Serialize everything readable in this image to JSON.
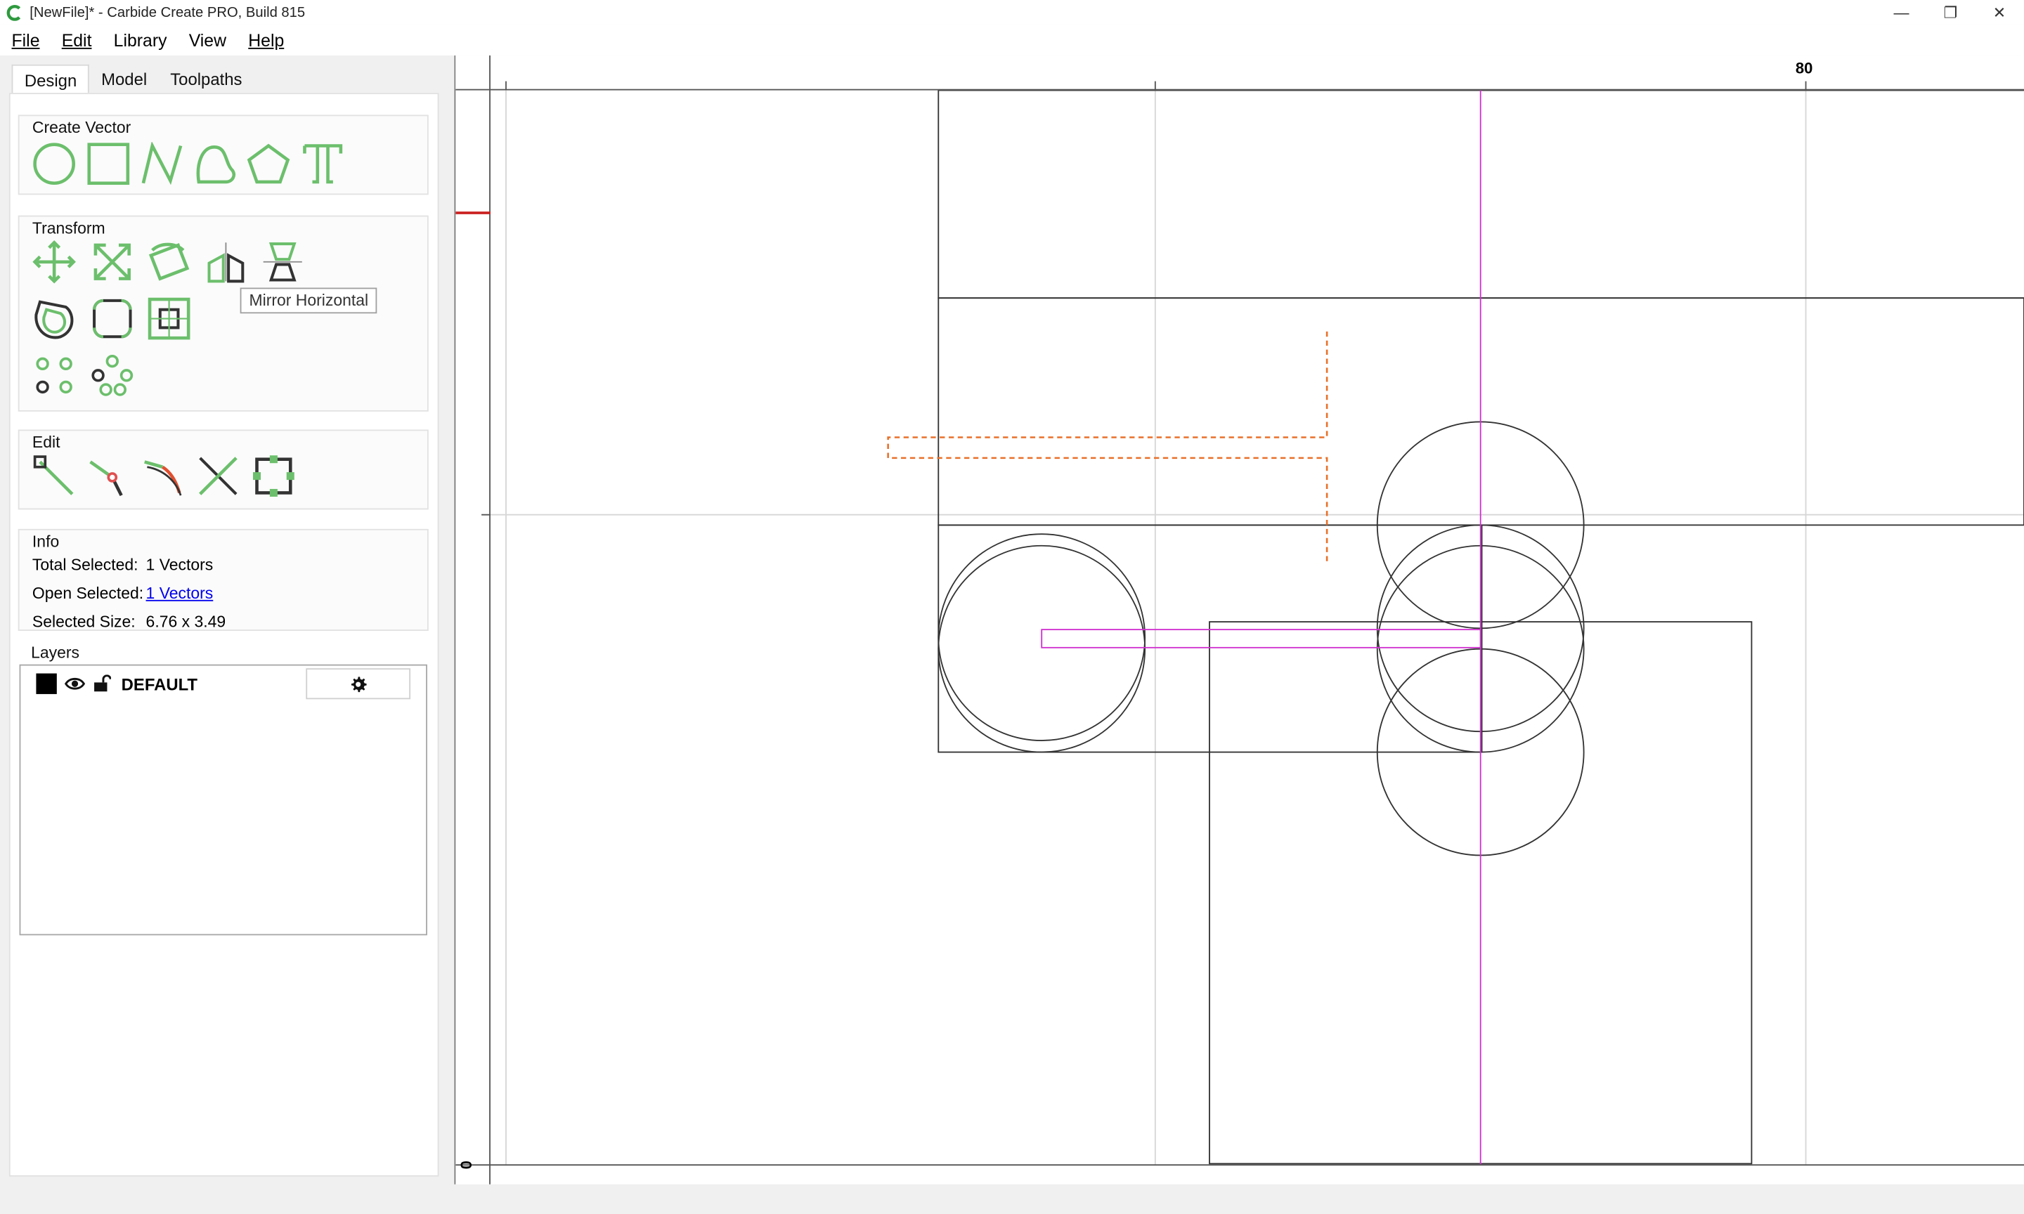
{
  "window": {
    "title": "[NewFile]* - Carbide Create PRO, Build 815",
    "controls": {
      "minimize": "—",
      "restore": "❐",
      "close": "✕"
    }
  },
  "menu": [
    {
      "label": "File"
    },
    {
      "label": "Edit"
    },
    {
      "label": "Library"
    },
    {
      "label": "View"
    },
    {
      "label": "Help"
    }
  ],
  "tabs": [
    {
      "label": "Design",
      "active": true
    },
    {
      "label": "Model",
      "active": false
    },
    {
      "label": "Toolpaths",
      "active": false
    }
  ],
  "create_vector": {
    "title": "Create Vector",
    "tools": [
      "circle-icon",
      "rectangle-icon",
      "polyline-icon",
      "curve-icon",
      "polygon-icon",
      "text-icon"
    ]
  },
  "transform": {
    "title": "Transform",
    "tools": [
      "move-icon",
      "scale-icon",
      "rotate-icon",
      "mirror-horizontal-icon",
      "mirror-vertical-icon",
      "offset-icon",
      "fillet-icon",
      "align-icon",
      "circular-array-icon",
      "scatter-array-icon"
    ],
    "tooltip": "Mirror Horizontal"
  },
  "edit": {
    "title": "Edit",
    "tools": [
      "node-edit-icon",
      "split-node-icon",
      "join-curve-icon",
      "trim-icon",
      "boolean-box-icon"
    ]
  },
  "info": {
    "title": "Info",
    "total_selected_label": "Total Selected:",
    "total_selected_value": "1 Vectors",
    "open_selected_label": "Open Selected:",
    "open_selected_value": "1 Vectors",
    "selected_size_label": "Selected Size:",
    "selected_size_value": "6.76 x 3.49"
  },
  "layers": {
    "title": "Layers",
    "items": [
      {
        "name": "DEFAULT",
        "color": "#000000",
        "visible": true,
        "locked": false
      }
    ]
  },
  "canvas": {
    "ruler_top_label": "80",
    "ruler_left_label": "0",
    "colors": {
      "geometry": "#333333",
      "selection": "#e8702a",
      "guide": "#d030d0",
      "tool_icon": "#6cbf6c",
      "marker": "#cc2222"
    }
  }
}
